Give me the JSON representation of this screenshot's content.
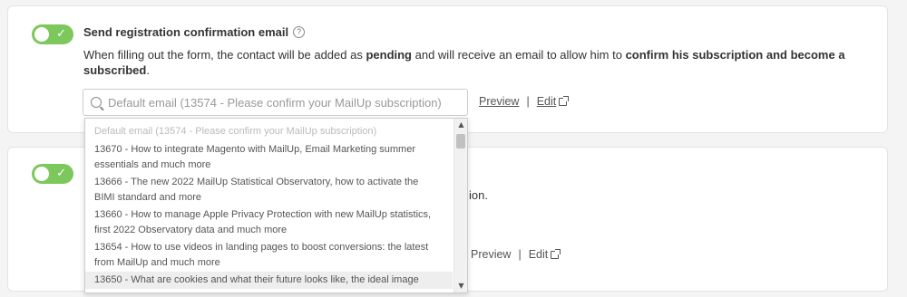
{
  "card1": {
    "title": "Send registration confirmation email",
    "help_icon": "?",
    "description_parts": [
      "When filling out the form, the contact will be added as ",
      "pending",
      " and will receive an email to allow him to ",
      "confirm his subscription and become a subscribed",
      "."
    ],
    "select_placeholder": "Default email (13574 - Please confirm your MailUp subscription)",
    "preview_label": "Preview",
    "separator": "|",
    "edit_label": "Edit"
  },
  "dropdown": {
    "options": [
      "Default email (13574 - Please confirm your MailUp subscription)",
      "13670 - How to integrate Magento with MailUp, Email Marketing summer essentials and much more",
      "13666 - The new 2022 MailUp Statistical Observatory, how to activate the BIMI standard and more",
      "13660 - How to manage Apple Privacy Protection with new MailUp statistics, first 2022 Observatory data and much more",
      "13654 - How to use videos in landing pages to boost conversions: the latest from MailUp and much more",
      "13650 - What are cookies and what their future looks like, the ideal image"
    ],
    "scroll_up": "▲",
    "scroll_down": "▼"
  },
  "card2": {
    "desc_tail": "ion.",
    "preview_label": "Preview",
    "separator": "|",
    "edit_label": "Edit"
  },
  "colors": {
    "toggle_on": "#7dc85c",
    "card_bg": "#ffffff",
    "page_bg": "#f4f4f5"
  },
  "toggles": {
    "card1_on": true,
    "card2_on": true,
    "check_glyph": "✓"
  }
}
